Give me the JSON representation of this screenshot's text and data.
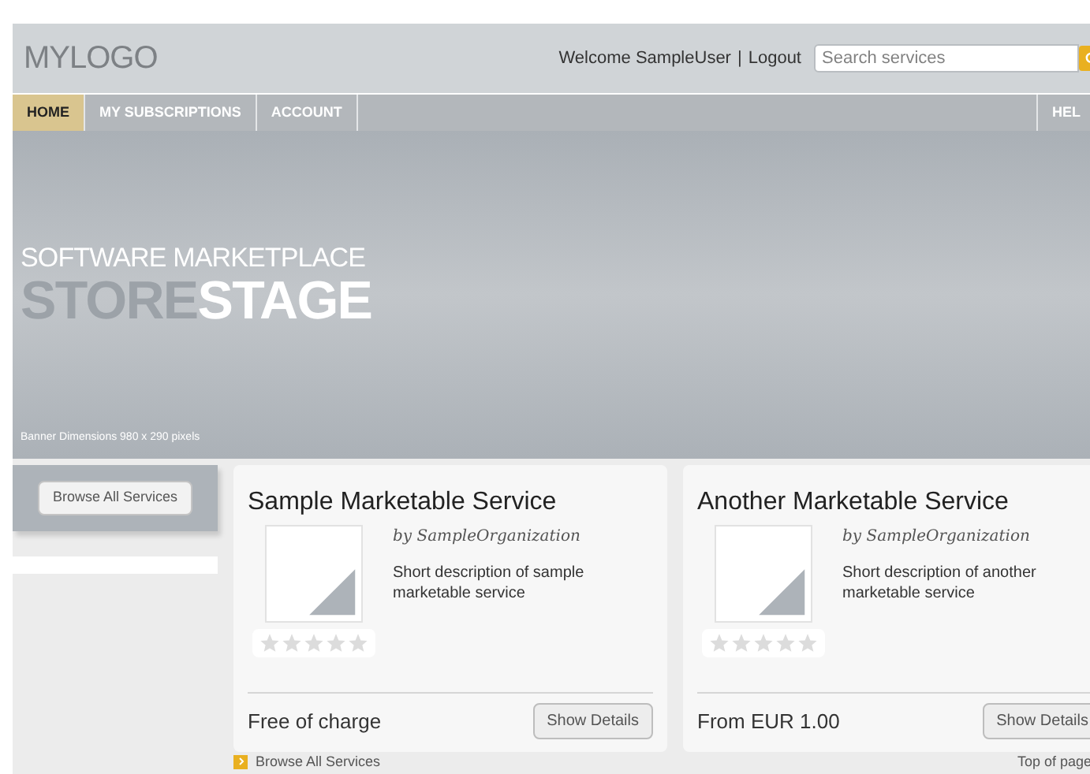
{
  "header": {
    "logo": "MYLOGO",
    "welcome": "Welcome SampleUser",
    "separator": "|",
    "logout": "Logout",
    "search": {
      "placeholder": "Search services"
    }
  },
  "nav": {
    "tabs": [
      {
        "label": "HOME",
        "selected": true
      },
      {
        "label": "MY SUBSCRIPTIONS",
        "selected": false
      },
      {
        "label": "ACCOUNT",
        "selected": false
      }
    ],
    "right_tab": "HEL"
  },
  "banner": {
    "kicker": "SOFTWARE MARKETPLACE",
    "title_light": "STORE",
    "title_bold": "STAGE",
    "note": "Banner Dimensions 980 x 290 pixels"
  },
  "sidebar": {
    "button": "Browse All Services"
  },
  "services": [
    {
      "name": "Sample Marketable Service",
      "vendor": "by SampleOrganization",
      "description": "Short description of sample marketable service",
      "stars": 0,
      "price": "Free of charge",
      "button": "Show Details"
    },
    {
      "name": "Another Marketable Service",
      "vendor": "by SampleOrganization",
      "description": "Short description of another marketable service",
      "stars": 0,
      "price": "From EUR 1.00",
      "button": "Show Details"
    }
  ],
  "footer": {
    "browse_link": "Browse All Services",
    "top_link": "Top of page"
  }
}
